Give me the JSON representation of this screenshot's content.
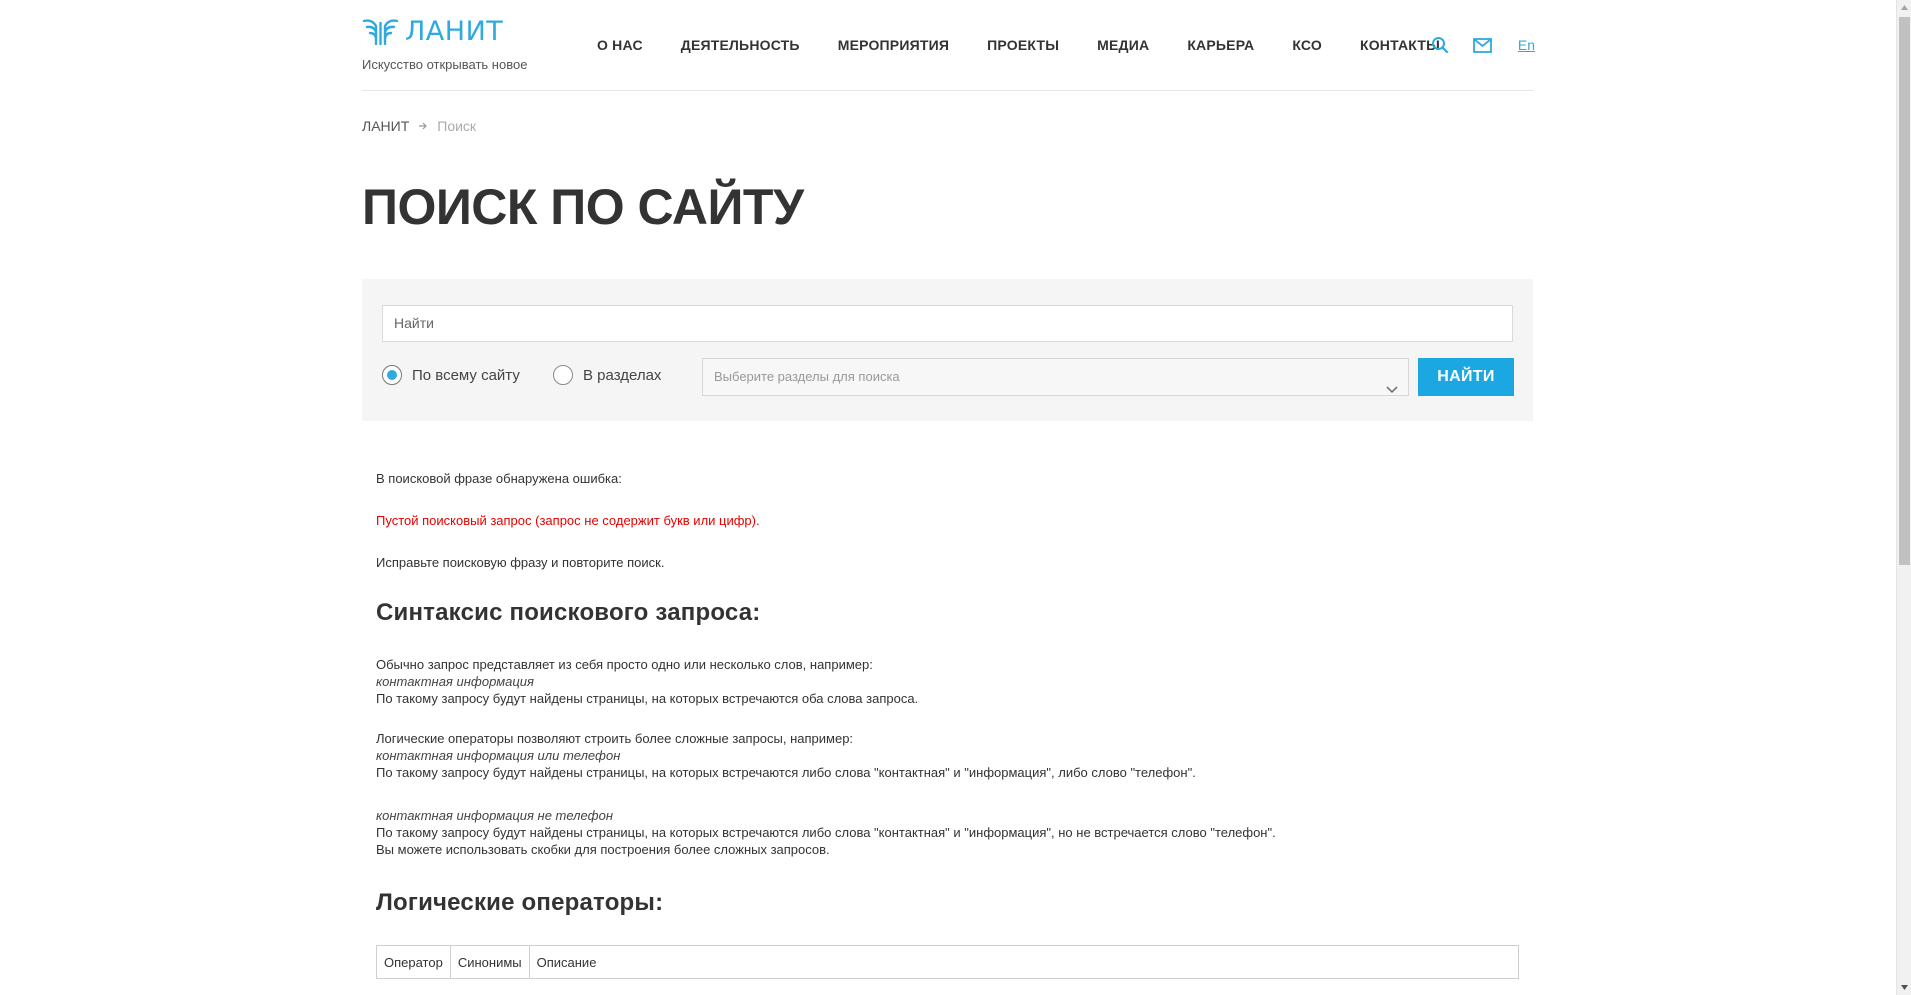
{
  "header": {
    "logo_text": "ЛАНИТ",
    "tagline": "Искусство открывать новое",
    "nav": [
      "О НАС",
      "ДЕЯТЕЛЬНОСТЬ",
      "МЕРОПРИЯТИЯ",
      "ПРОЕКТЫ",
      "МЕДИА",
      "КАРЬЕРА",
      "КСО",
      "КОНТАКТЫ"
    ],
    "lang": "En"
  },
  "breadcrumb": {
    "home": "ЛАНИТ",
    "current": "Поиск"
  },
  "page_title": "ПОИСК ПО САЙТУ",
  "search": {
    "placeholder": "Найти",
    "radio_all": "По всему сайту",
    "radio_sections": "В разделах",
    "sections_placeholder": "Выберите разделы для поиска",
    "button": "НАЙТИ",
    "selected": "all"
  },
  "content": {
    "error_head": "В поисковой фразе обнаружена ошибка:",
    "error_msg": "Пустой поисковый запрос (запрос не содержит букв или цифр).",
    "error_fix": "Исправьте поисковую фразу и повторите поиск.",
    "syntax_title": "Синтаксис поискового запроса:",
    "block1": {
      "line1": "Обычно запрос представляет из себя просто одно или несколько слов, например:",
      "example": "контактная информация",
      "line2": "По такому запросу будут найдены страницы, на которых встречаются оба слова запроса."
    },
    "block2": {
      "line1": "Логические операторы позволяют строить более сложные запросы, например:",
      "example": "контактная информация или телефон",
      "line2": "По такому запросу будут найдены страницы, на которых встречаются либо слова \"контактная\" и \"информация\", либо слово \"телефон\"."
    },
    "block3": {
      "example": "контактная информация не телефон",
      "line1": "По такому запросу будут найдены страницы, на которых встречаются либо слова \"контактная\" и \"информация\", но не встречается слово \"телефон\".",
      "line2": "Вы можете использовать скобки для построения более сложных запросов."
    },
    "ops_title": "Логические операторы:",
    "table": {
      "headers": [
        "Оператор",
        "Синонимы",
        "Описание"
      ]
    }
  },
  "colors": {
    "accent": "#2eaae1",
    "button": "#1ba8e2",
    "error": "#e60000"
  }
}
